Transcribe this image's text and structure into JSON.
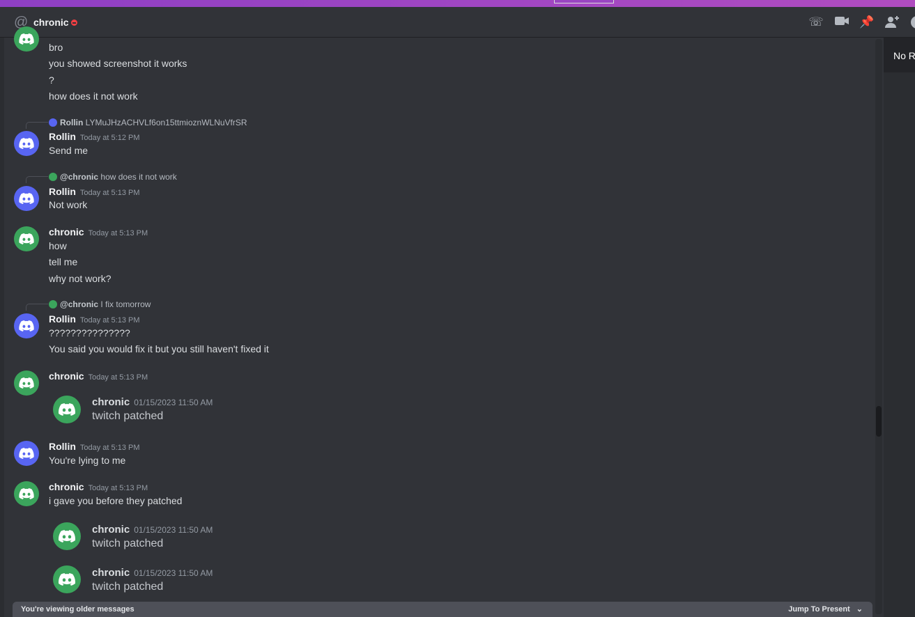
{
  "header": {
    "channel_name": "chronic",
    "status": "dnd",
    "icons": [
      "at-icon",
      "voice-call-icon",
      "video-call-icon",
      "pin-icon",
      "add-friend-icon",
      "profile-icon"
    ]
  },
  "right_panel": {
    "text": "No Re"
  },
  "messages": {
    "m0": {
      "lines": [
        "bro",
        "you showed screenshot it works",
        "?",
        "how does it not work"
      ]
    },
    "m1": {
      "reply_author": "Rollin",
      "reply_text": "LYMuJHzACHVLf6on15ttmioznWLNuVfrSR",
      "author": "Rollin",
      "time": "Today at 5:12 PM",
      "lines": [
        "Send me"
      ]
    },
    "m2": {
      "reply_author": "@chronic",
      "reply_text": "how does it not work",
      "author": "Rollin",
      "time": "Today at 5:13 PM",
      "lines": [
        "Not work"
      ]
    },
    "m3": {
      "author": "chronic",
      "time": "Today at 5:13 PM",
      "lines": [
        "how",
        "tell me",
        "why not work?"
      ]
    },
    "m4": {
      "reply_author": "@chronic",
      "reply_text": "I fix tomorrow",
      "author": "Rollin",
      "time": "Today at 5:13 PM",
      "lines": [
        "???????????????",
        "You said you would fix it but you still haven't fixed it"
      ]
    },
    "m5": {
      "author": "chronic",
      "time": "Today at 5:13 PM",
      "embed": {
        "author": "chronic",
        "time": "01/15/2023 11:50 AM",
        "text": "twitch patched"
      }
    },
    "m6": {
      "author": "Rollin",
      "time": "Today at 5:13 PM",
      "lines": [
        "You're lying to me"
      ]
    },
    "m7": {
      "author": "chronic",
      "time": "Today at 5:13 PM",
      "lines": [
        "i gave you before they patched"
      ],
      "embeds": [
        {
          "author": "chronic",
          "time": "01/15/2023 11:50 AM",
          "text": "twitch patched"
        },
        {
          "author": "chronic",
          "time": "01/15/2023 11:50 AM",
          "text": "twitch patched"
        }
      ]
    }
  },
  "bottom_bar": {
    "notice": "You're viewing older messages",
    "jump_label": "Jump To Present"
  },
  "colors": {
    "chronic_avatar": "#3ba55c",
    "rollin_avatar": "#5865f2",
    "dnd": "#f23f43",
    "background": "#313338"
  }
}
